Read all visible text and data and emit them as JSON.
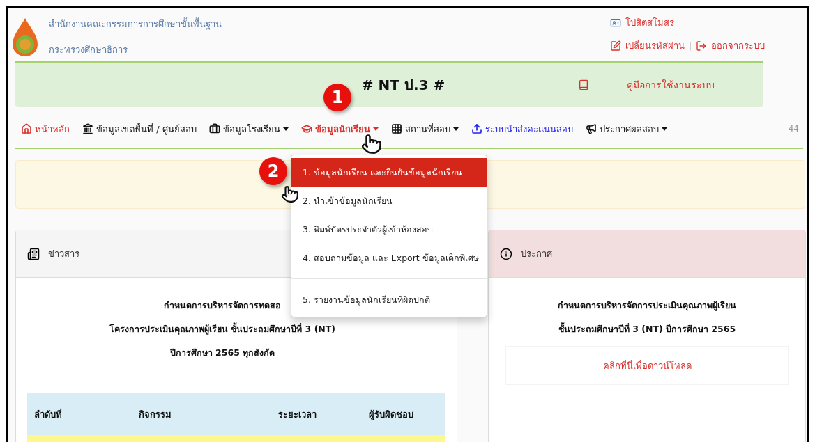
{
  "header": {
    "org_lines": [
      "สำนักงานคณะกรรมการการศึกษาขั้นพื้นฐาน",
      "กระทรวงศึกษาธิการ"
    ],
    "user_name": "โปสิตสโมสร",
    "change_password": "เปลี่ยนรหัสผ่าน",
    "separator": "|",
    "logout": "ออกจากระบบ"
  },
  "banner": {
    "title": "# NT ป.3 #",
    "manual": "คู่มือการใช้งานระบบ"
  },
  "nav": {
    "items": [
      {
        "label": "หน้าหลัก",
        "dropdown": false,
        "selected": false,
        "color": "#d9302c"
      },
      {
        "label": "ข้อมูลเขตพื้นที่ / ศูนย์สอบ",
        "dropdown": false,
        "selected": false,
        "color": "#111111"
      },
      {
        "label": "ข้อมูลโรงเรียน",
        "dropdown": true,
        "selected": false,
        "color": "#111111"
      },
      {
        "label": "ข้อมูลนักเรียน",
        "dropdown": true,
        "selected": true,
        "color": "#d9302c"
      },
      {
        "label": "สถานที่สอบ",
        "dropdown": true,
        "selected": false,
        "color": "#111111"
      },
      {
        "label": "ระบบนำส่งคะแนนสอบ",
        "dropdown": false,
        "selected": false,
        "color": "#2222ee"
      },
      {
        "label": "ประกาศผลสอบ",
        "dropdown": true,
        "selected": false,
        "color": "#111111"
      }
    ],
    "counter": "44"
  },
  "dropdown": {
    "items": [
      {
        "label": "1. ข้อมูลนักเรียน และยืนยันข้อมูลนักเรียน",
        "selected": true,
        "divider_before": false
      },
      {
        "label": "2. นำเข้าข้อมูลนักเรียน",
        "selected": false,
        "divider_before": false
      },
      {
        "label": "3. พิมพ์บัตรประจำตัวผู้เข้าห้องสอบ",
        "selected": false,
        "divider_before": false
      },
      {
        "label": "4. สอบถามข้อมูล และ Export ข้อมูลเด็กพิเศษ",
        "selected": false,
        "divider_before": false
      },
      {
        "label": "5. รายงานข้อมูลนักเรียนที่ผิดปกติ",
        "selected": false,
        "divider_before": true
      }
    ]
  },
  "annotations": [
    "1",
    "2"
  ],
  "news": {
    "title": "ข่าวสาร",
    "lines": [
      "กำหนดการบริหารจัดการทดสอ",
      "โครงการประเมินคุณภาพผู้เรียน ชั้นประถมศึกษาปีที่ 3 (NT)",
      "ปีการศึกษา 2565 ทุกสังกัด"
    ],
    "table": {
      "columns": [
        "ลำดับที่",
        "กิจกรรม",
        "ระยะเวลา",
        "ผู้รับผิดชอบ"
      ]
    }
  },
  "announcement": {
    "title": "ประกาศ",
    "lines": [
      "กำหนดการบริหารจัดการประเมินคุณภาพผู้เรียน",
      "ชั้นประถมศึกษาปีที่ 3 (NT) ปีการศึกษา 2565"
    ],
    "link": "คลิกที่นี่เพื่อดาวน์โหลด"
  }
}
